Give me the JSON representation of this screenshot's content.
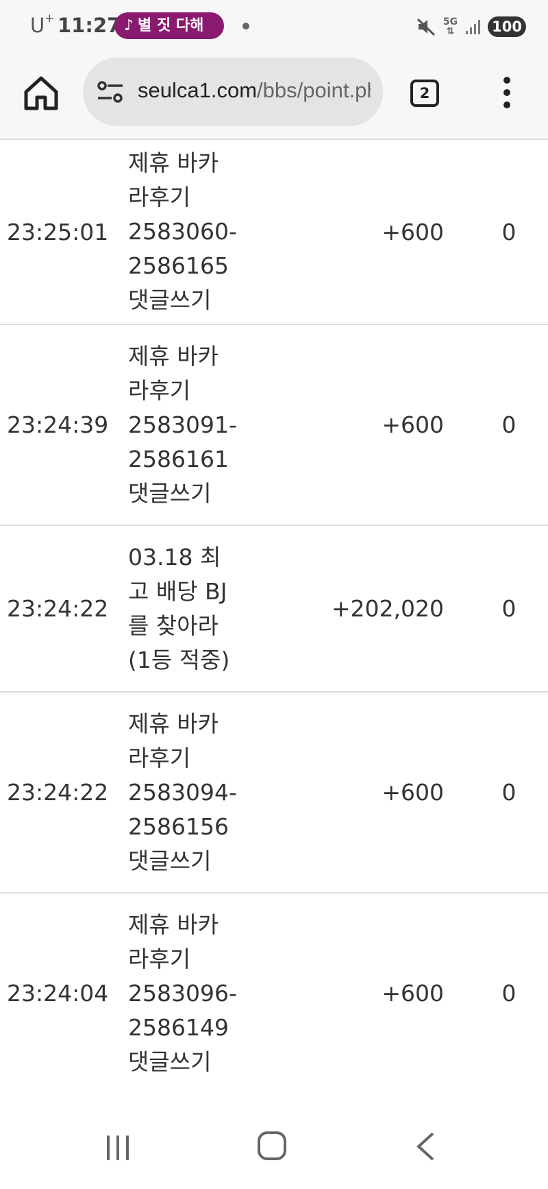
{
  "status_bar": {
    "carrier": "U",
    "carrier_sup": "+",
    "time": "11:27",
    "now_playing": "별 짓 다해",
    "network": "5G",
    "battery": "100"
  },
  "browser": {
    "url_domain": "seulca1.com",
    "url_path": "/bbs/point.php",
    "tab_count": "2"
  },
  "rows": [
    {
      "time": "23:25:01",
      "desc": [
        "제휴 바카",
        "라후기",
        "2583060-",
        "2586165",
        "댓글쓰기"
      ],
      "point": "+600",
      "balance": "0"
    },
    {
      "time": "23:24:39",
      "desc": [
        "제휴 바카",
        "라후기",
        "2583091-",
        "2586161",
        "댓글쓰기"
      ],
      "point": "+600",
      "balance": "0"
    },
    {
      "time": "23:24:22",
      "desc": [
        "03.18 최",
        "고 배당 BJ",
        "를 찾아라",
        "(1등 적중)"
      ],
      "point": "+202,020",
      "balance": "0"
    },
    {
      "time": "23:24:22",
      "desc": [
        "제휴 바카",
        "라후기",
        "2583094-",
        "2586156",
        "댓글쓰기"
      ],
      "point": "+600",
      "balance": "0"
    },
    {
      "time": "23:24:04",
      "desc": [
        "제휴 바카",
        "라후기",
        "2583096-",
        "2586149",
        "댓글쓰기"
      ],
      "point": "+600",
      "balance": "0"
    }
  ]
}
